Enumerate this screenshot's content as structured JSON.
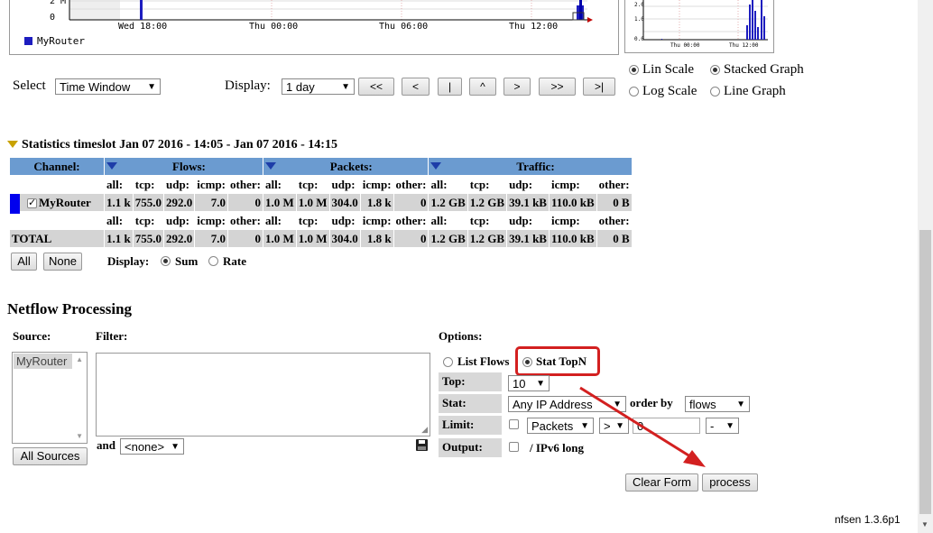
{
  "graph": {
    "y_labels": [
      "2 M",
      "0"
    ],
    "x_labels": [
      "Wed 18:00",
      "Thu 00:00",
      "Thu 06:00",
      "Thu 12:00"
    ],
    "legend": "MyRouter",
    "legend_color": "#1d1dbf",
    "thumb_y_labels": [
      "2.0",
      "1.0",
      "0.0"
    ],
    "thumb_x_labels": [
      "Thu 00:00",
      "Thu 12:00"
    ]
  },
  "select_row": {
    "select_label": "Select",
    "select_value": "Time Window",
    "display_label": "Display:",
    "display_value": "1 day",
    "nav_buttons": [
      "<<",
      "<",
      "|",
      "^",
      ">",
      ">>",
      ">|"
    ]
  },
  "scale_options": {
    "lin": "Lin Scale",
    "log": "Log Scale",
    "stacked": "Stacked Graph",
    "line": "Line Graph"
  },
  "stats": {
    "title": "Statistics timeslot Jan 07 2016 - 14:05 - Jan 07 2016 - 14:15",
    "channel_header": "Channel:",
    "flows_header": "Flows:",
    "packets_header": "Packets:",
    "traffic_header": "Traffic:",
    "subheaders": [
      "all:",
      "tcp:",
      "udp:",
      "icmp:",
      "other:"
    ],
    "router": {
      "name": "MyRouter",
      "color": "#0000ee",
      "flows": [
        "1.1 k",
        "755.0",
        "292.0",
        "7.0",
        "0"
      ],
      "packets": [
        "1.0 M",
        "1.0 M",
        "304.0",
        "1.8 k",
        "0"
      ],
      "traffic": [
        "1.2 GB",
        "1.2 GB",
        "39.1 kB",
        "110.0 kB",
        "0 B"
      ]
    },
    "total": {
      "name": "TOTAL",
      "flows": [
        "1.1 k",
        "755.0",
        "292.0",
        "7.0",
        "0"
      ],
      "packets": [
        "1.0 M",
        "1.0 M",
        "304.0",
        "1.8 k",
        "0"
      ],
      "traffic": [
        "1.2 GB",
        "1.2 GB",
        "39.1 kB",
        "110.0 kB",
        "0 B"
      ]
    },
    "all_button": "All",
    "none_button": "None",
    "display_label": "Display:",
    "sum_label": "Sum",
    "rate_label": "Rate"
  },
  "netflow": {
    "title": "Netflow Processing",
    "source_label": "Source:",
    "source_item": "MyRouter",
    "all_sources_button": "All Sources",
    "filter_label": "Filter:",
    "and_label": "and",
    "and_select": "<none>",
    "options_label": "Options:",
    "list_flows": "List Flows",
    "stat_topn": "Stat TopN",
    "top_label": "Top:",
    "top_value": "10",
    "stat_label": "Stat:",
    "stat_value": "Any IP Address",
    "order_by_label": "order by",
    "order_by_value": "flows",
    "limit_label": "Limit:",
    "limit_select": "Packets",
    "limit_op": ">",
    "limit_value": "0",
    "limit_unit": "-",
    "output_label": "Output:",
    "ipv6_label": "/ IPv6 long",
    "clear_button": "Clear Form",
    "process_button": "process"
  },
  "footer": {
    "version": "nfsen 1.3.6p1"
  },
  "annotation_color": "#d32020"
}
